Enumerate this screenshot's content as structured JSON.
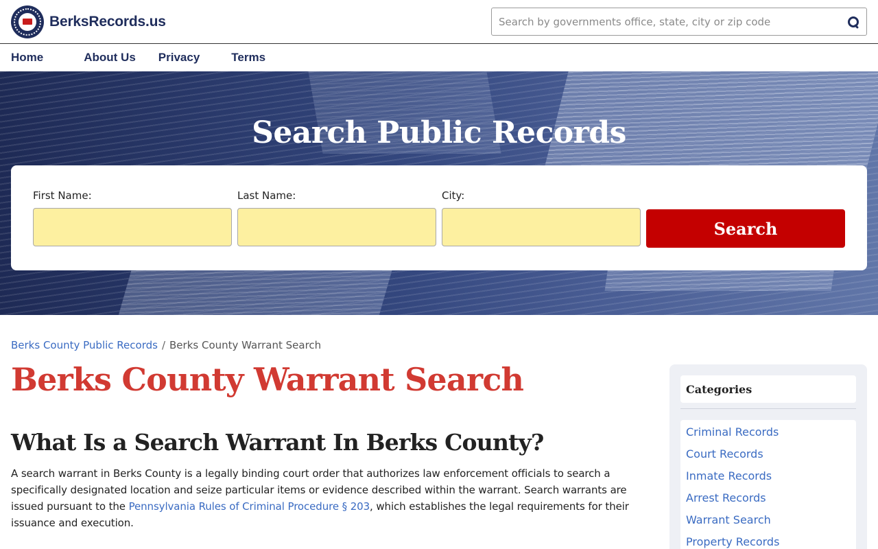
{
  "header": {
    "brand_name": "BerksRecords.us",
    "logo_icon": "seal-logo-icon",
    "search_placeholder": "Search by governments office, state, city or zip code"
  },
  "nav": {
    "items": [
      "Home",
      "About Us",
      "Privacy",
      "Terms"
    ]
  },
  "hero": {
    "title": "Search Public Records",
    "fields": {
      "first_name_label": "First Name:",
      "last_name_label": "Last Name:",
      "city_label": "City:"
    },
    "button_label": "Search"
  },
  "breadcrumb": {
    "parent": "Berks County Public Records",
    "separator": "/",
    "current": "Berks County Warrant Search"
  },
  "article": {
    "title": "Berks County Warrant Search",
    "heading": "What Is a Search Warrant In Berks County?",
    "para_before": "A search warrant in Berks County is a legally binding court order that authorizes law enforcement officials to search a specifically designated location and seize particular items or evidence described within the warrant. Search warrants are issued pursuant to the ",
    "para_link": "Pennsylvania Rules of Criminal Procedure § 203",
    "para_after": ", which establishes the legal requirements for their issuance and execution."
  },
  "sidebar": {
    "heading": "Categories",
    "items": [
      "Criminal Records",
      "Court Records",
      "Inmate Records",
      "Arrest Records",
      "Warrant Search",
      "Property Records"
    ]
  },
  "colors": {
    "brand_navy": "#1f2d5c",
    "title_red": "#d13a32",
    "button_red": "#c40000",
    "input_yellow": "#fdf0a0",
    "link_blue": "#3a6bc2"
  }
}
